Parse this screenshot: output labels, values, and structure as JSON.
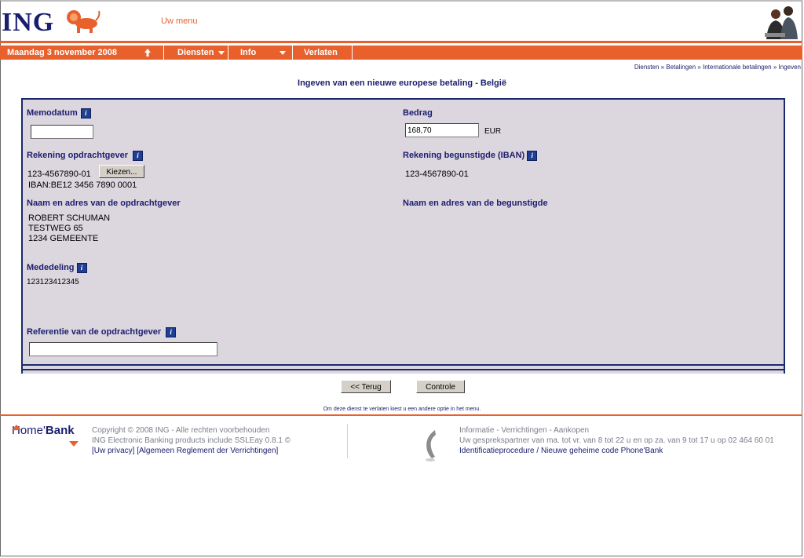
{
  "header": {
    "logo_text": "ING",
    "menu_link": "Uw menu"
  },
  "nav": {
    "date": "Maandag 3 november 2008",
    "items": [
      "Diensten",
      "Info",
      "Verlaten"
    ]
  },
  "breadcrumb": "Diensten » Betalingen » Internationale betalingen » Ingeven",
  "page_title": "Ingeven van een nieuwe europese betaling - België",
  "form": {
    "memodatum_label": "Memodatum",
    "memodatum_value": "",
    "bedrag_label": "Bedrag",
    "bedrag_value": "168,70",
    "currency": "EUR",
    "rek_opdrachtgever_label": "Rekening opdrachtgever",
    "rek_opdrachtgever_value": "123-4567890-01",
    "kiezen_button": "Kiezen...",
    "iban_value": "IBAN:BE12 3456 7890 0001",
    "rek_begunstigde_label": "Rekening begunstigde (IBAN)",
    "rek_begunstigde_value": "123-4567890-01",
    "naam_opdrachtgever_label": "Naam en adres van de opdrachtgever",
    "naam_opdrachtgever_lines": [
      "ROBERT SCHUMAN",
      "TESTWEG 65",
      "1234 GEMEENTE"
    ],
    "naam_begunstigde_label": "Naam en adres van de begunstigde",
    "mededeling_label": "Mededeling",
    "mededeling_value": "123123412345",
    "referentie_label": "Referentie van de opdrachtgever",
    "referentie_value": ""
  },
  "buttons": {
    "back": "<< Terug",
    "check": "Controle"
  },
  "note": "Om deze dienst te verlaten kiest u een andere optie in het menu.",
  "footer": {
    "brand_home": "Home'",
    "brand_bank": "Bank",
    "copyright": "Copyright © 2008 ING - Alle rechten voorbehouden",
    "products": "ING Electronic Banking products include SSLEay 0.8.1 ©",
    "privacy_link": "[Uw privacy]",
    "reglement_link": "[Algemeen Reglement der Verrichtingen]",
    "info_title": "Informatie - Verrichtingen - Aankopen",
    "info_hours": "Uw gesprekspartner van ma. tot vr. van 8 tot 22 u en op za. van 9 tot 17 u op 02 464 60 01",
    "info_link": "Identificatieprocedure / Nieuwe geheime code Phone'Bank"
  },
  "colors": {
    "accent": "#e8612c",
    "navy": "#1a1e6e",
    "panel": "#dcd6df"
  }
}
